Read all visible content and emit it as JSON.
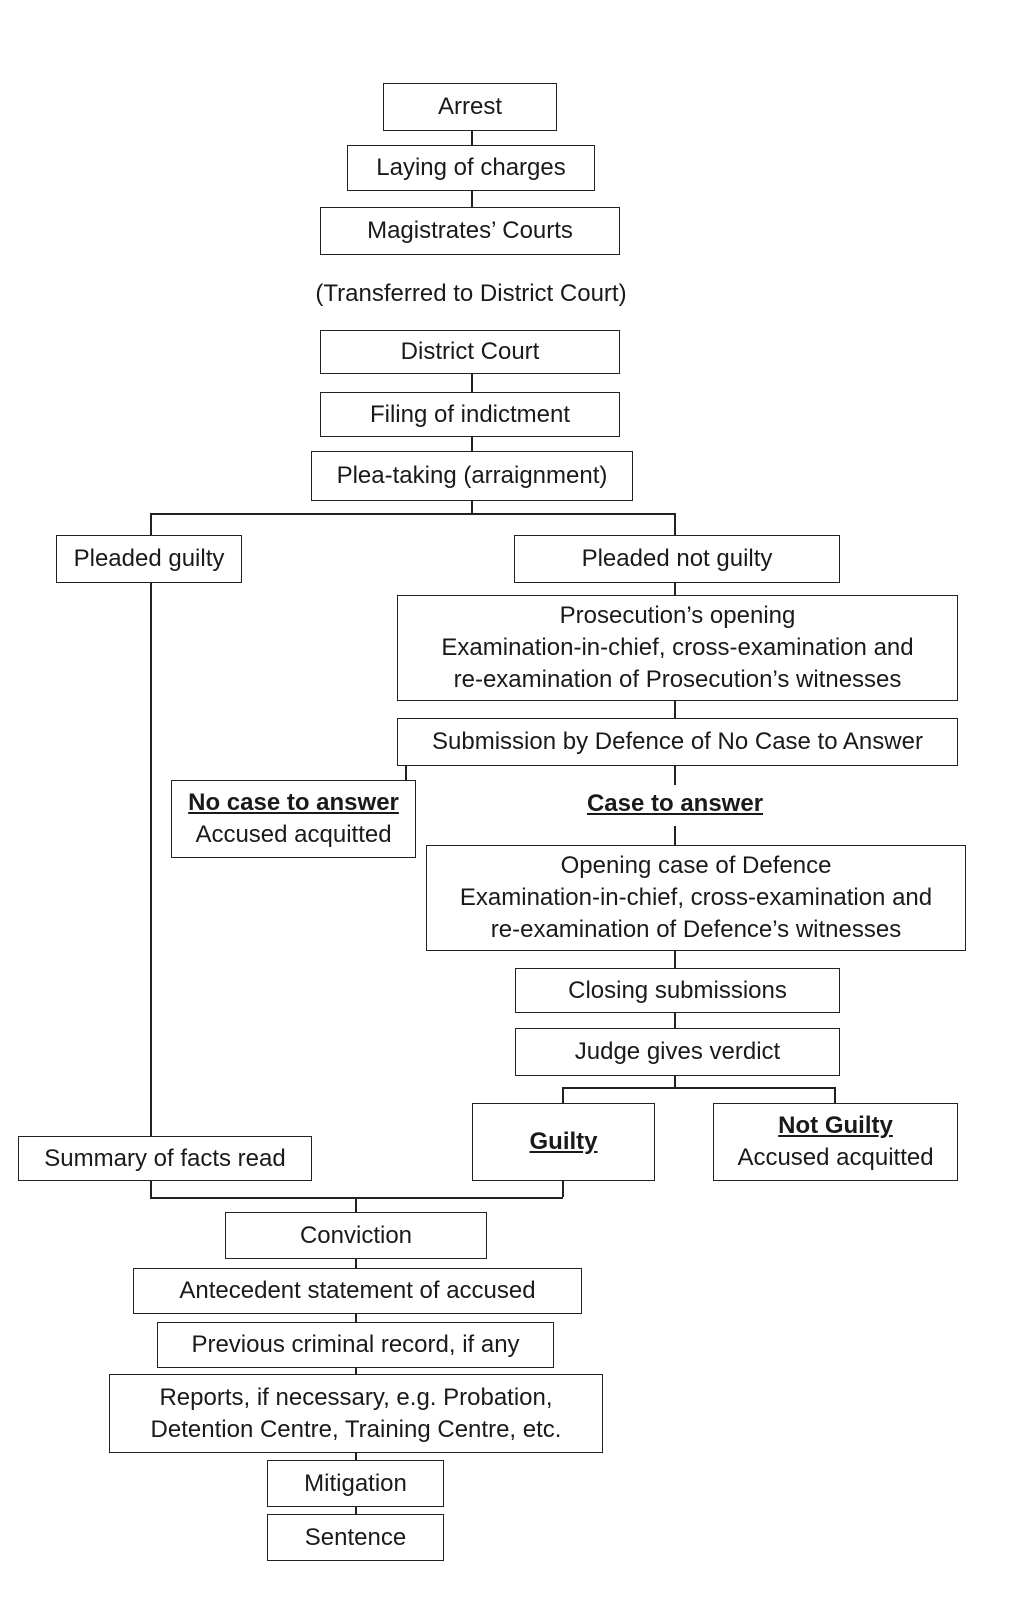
{
  "nodes": {
    "arrest": "Arrest",
    "laying_charges": "Laying of charges",
    "magistrates": "Magistrates’ Courts",
    "transferred": "(Transferred to District Court)",
    "district_court": "District Court",
    "filing_indictment": "Filing of indictment",
    "plea_taking": "Plea-taking (arraignment)",
    "pleaded_guilty": "Pleaded guilty",
    "pleaded_not_guilty": "Pleaded not guilty",
    "prosecution": [
      "Prosecution’s opening",
      "Examination-in-chief, cross-examination and",
      "re-examination of Prosecution’s witnesses"
    ],
    "submission_no_case": "Submission by Defence of No Case to Answer",
    "no_case_title": "No case to answer",
    "no_case_sub": "Accused acquitted",
    "case_to_answer": "Case to answer",
    "defence": [
      "Opening case of Defence",
      "Examination-in-chief, cross-examination and",
      "re-examination of Defence’s witnesses"
    ],
    "closing": "Closing submissions",
    "verdict": "Judge gives verdict",
    "guilty": "Guilty",
    "not_guilty_title": "Not Guilty",
    "not_guilty_sub": "Accused acquitted",
    "summary_facts": "Summary of facts read",
    "conviction": "Conviction",
    "antecedent": "Antecedent statement of accused",
    "previous_record": "Previous criminal record, if any",
    "reports": [
      "Reports, if necessary, e.g. Probation,",
      "Detention Centre, Training Centre, etc."
    ],
    "mitigation": "Mitigation",
    "sentence": "Sentence"
  }
}
